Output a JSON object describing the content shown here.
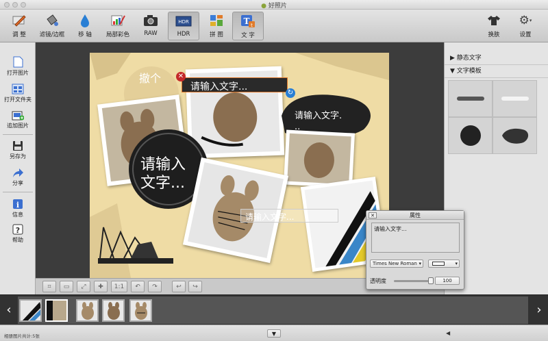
{
  "window": {
    "title": "好照片"
  },
  "toolbar": {
    "items": [
      {
        "label": "调 整"
      },
      {
        "label": "滤镜/边框"
      },
      {
        "label": "移 轴"
      },
      {
        "label": "局部彩色"
      },
      {
        "label": "RAW"
      },
      {
        "label": "HDR"
      },
      {
        "label": "拼 图"
      },
      {
        "label": "文 字"
      }
    ],
    "right": [
      {
        "label": "换肤"
      },
      {
        "label": "设置"
      }
    ]
  },
  "left_panel": {
    "items": [
      {
        "label": "打开图片"
      },
      {
        "label": "打开文件夹"
      },
      {
        "label": "追加图片"
      },
      {
        "label": "另存为"
      },
      {
        "label": "分享"
      },
      {
        "label": "信息"
      },
      {
        "label": "帮助"
      }
    ]
  },
  "canvas": {
    "undo_text": "撤个",
    "text_box_1": "请输入文字...",
    "text_box_2": "请输入文字.",
    "text_box_2_line2": "..",
    "text_box_3_line1": "请输入",
    "text_box_3_line2": "文字...",
    "text_box_4": "请输入文字..."
  },
  "bottom_toolbar": {
    "ratio_label": "1:1"
  },
  "right_panel": {
    "section1": "静态文字",
    "section2": "文字模板"
  },
  "properties": {
    "title": "属性",
    "text_value": "请输入文字...",
    "font": "Times New Roman",
    "opacity_label": "透明度",
    "opacity_value": "100"
  },
  "status": {
    "text": "相册图片共计:5张"
  },
  "colors": {
    "accent": "#e0782a",
    "dark_panel": "#3c3c3c"
  }
}
